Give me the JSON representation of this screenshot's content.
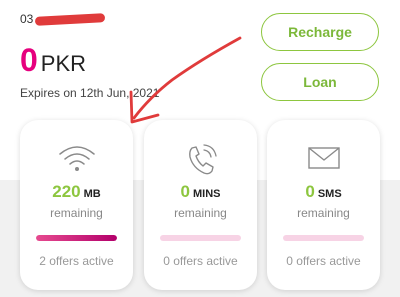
{
  "account": {
    "phone_prefix": "03",
    "balance_amount": "0",
    "currency": "PKR",
    "expiry_text": "Expires on 12th Jun, 2021"
  },
  "actions": {
    "recharge_label": "Recharge",
    "loan_label": "Loan"
  },
  "cards": [
    {
      "value": "220",
      "unit": "MB",
      "remaining_label": "remaining",
      "offers_text": "2 offers active",
      "progress": 1.0,
      "icon": "wifi-icon"
    },
    {
      "value": "0",
      "unit": "MINS",
      "remaining_label": "remaining",
      "offers_text": "0 offers active",
      "progress": 0,
      "icon": "phone-icon"
    },
    {
      "value": "0",
      "unit": "SMS",
      "remaining_label": "remaining",
      "offers_text": "0 offers active",
      "progress": 0,
      "icon": "envelope-icon"
    }
  ],
  "colors": {
    "accent_green": "#8dc63f",
    "balance_magenta": "#e6007e",
    "progress_magenta": "#c2187a",
    "annotation_red": "#e03b3b"
  }
}
